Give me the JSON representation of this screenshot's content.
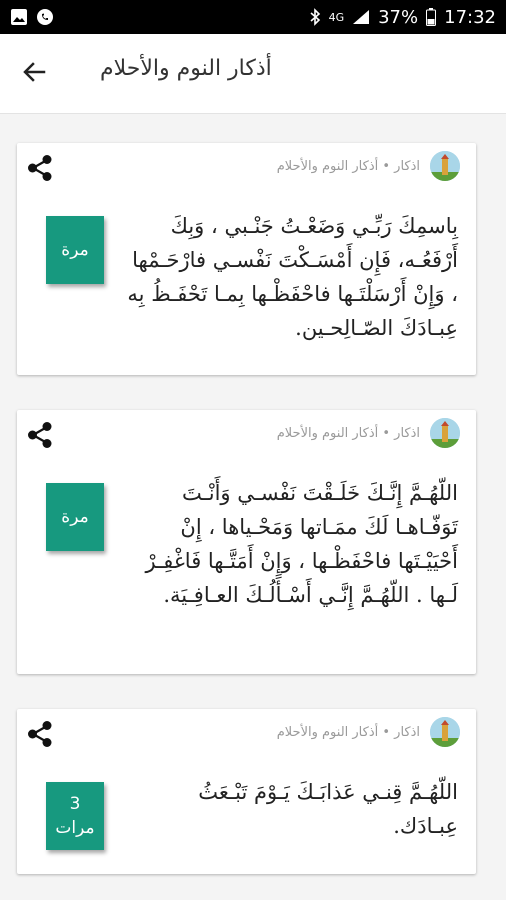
{
  "status_bar": {
    "battery_percent": "37%",
    "time": "17:32",
    "network": "4G"
  },
  "app_bar": {
    "title": "أذكار النوم والأحلام",
    "back_icon": "arrow-back-icon"
  },
  "cards": [
    {
      "meta": "اذكار • أذكار النوم والأحلام",
      "text": "بِاسمِكَ رَبِّـي وَضَعْـتُ جَنْـبي ، وَبِكَ أَرْفَعُـه، فَإِن أَمْسَـكْتَ نَفْسـي فارْحَـمْها ، وَإِنْ أَرْسَلْتَـها فاحْفَظْـها بِمـا تَحْفَـظُ بِه عِبـادَكَ الصّـالِحـين.",
      "count": [
        "مرة"
      ]
    },
    {
      "meta": "اذكار • أذكار النوم والأحلام",
      "text": "اللّهُـمَّ إِنَّـكَ خَلَـقْتَ نَفْسـي وَأَنْـتَ تَوَفّـاهـا لَكَ ممَـاتها وَمَحْـياها ، إِنْ أَحْيَيْـتَها فاحْفَظْـها ، وَإِنْ أَمَتَّـها فَاغْفِـرْ لَـها . اللّهُـمَّ إِنَّـي أَسْـأَلُـكَ العـافِـيَة.",
      "count": [
        "مرة"
      ]
    },
    {
      "meta": "اذكار • أذكار النوم والأحلام",
      "text": "اللّهُـمَّ قِنـي عَذابَـكَ يَـوْمَ تَبْـعَثُ عِبـادَك.",
      "count": [
        "3",
        "مرات"
      ]
    }
  ],
  "colors": {
    "accent": "#17997f",
    "status_bar": "#000000"
  }
}
